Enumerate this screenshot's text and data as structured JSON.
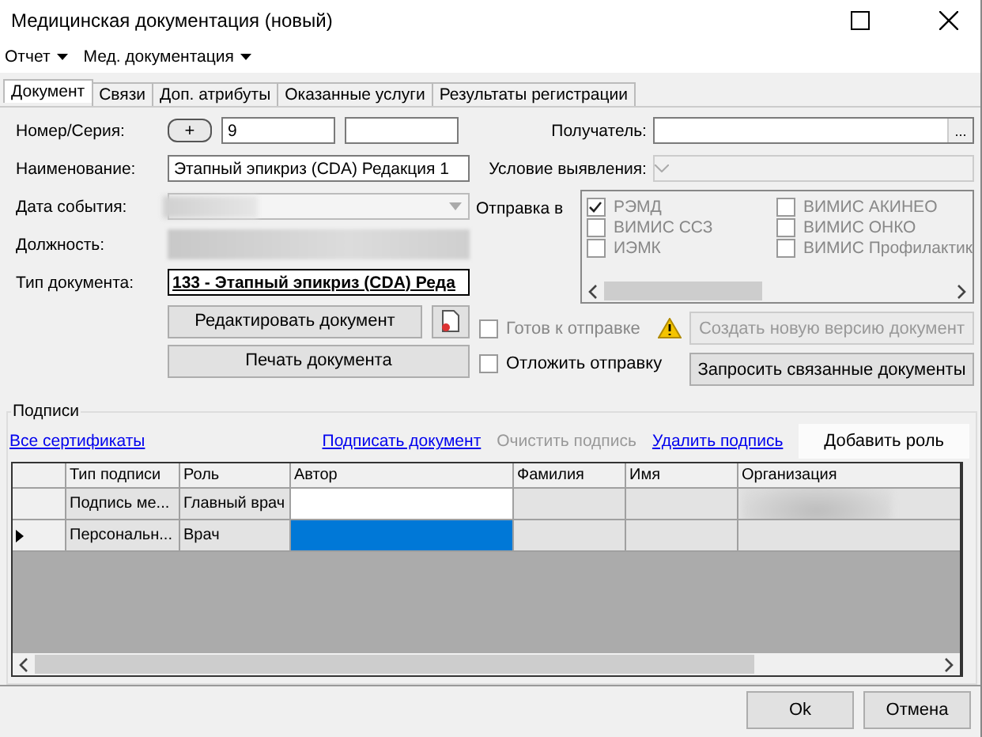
{
  "window": {
    "title": "Медицинская документация (новый)"
  },
  "menu": [
    "Отчет",
    "Мед. документация"
  ],
  "tabs": [
    {
      "label": "Документ",
      "selected": true
    },
    {
      "label": "Связи",
      "selected": false
    },
    {
      "label": "Доп. атрибуты",
      "selected": false
    },
    {
      "label": "Оказанные услуги",
      "selected": false
    },
    {
      "label": "Результаты регистрации",
      "selected": false
    }
  ],
  "form": {
    "number_label": "Номер/Серия:",
    "add_button": "+",
    "number": "9",
    "name_label": "Наименование:",
    "name": "Этапный эпикриз (CDA) Редакция 1",
    "date_label": "Дата события:",
    "position_label": "Должность:",
    "doctype_label": "Тип документа:",
    "doctype": "133 - Этапный эпикриз (CDA) Реда",
    "edit_button": "Редактировать документ",
    "print_button": "Печать документа",
    "recipient_label": "Получатель:",
    "recipient_button": "...",
    "condition_label": "Условие выявления:",
    "send_label": "Отправка в",
    "send_targets": [
      {
        "label": "РЭМД",
        "checked": true
      },
      {
        "label": "ВИМИС АКИНЕО",
        "checked": false
      },
      {
        "label": "ВИМИС ССЗ",
        "checked": false
      },
      {
        "label": "ВИМИС ОНКО",
        "checked": false
      },
      {
        "label": "ИЭМК",
        "checked": false
      },
      {
        "label": "ВИМИС Профилактик",
        "checked": false
      }
    ],
    "options": [
      {
        "label": "Готов к отправке",
        "checked": false,
        "disabled": true,
        "warning": true
      },
      {
        "label": "Отложить отправку",
        "checked": false,
        "disabled": false,
        "warning": false
      }
    ],
    "actions": [
      {
        "label": "Создать новую версию документ",
        "disabled": true
      },
      {
        "label": "Запросить связанные документы",
        "disabled": false
      }
    ]
  },
  "signatures": {
    "title": "Подписи",
    "left_link": "Все сертификаты",
    "links": [
      {
        "label": "Подписать документ",
        "disabled": false
      },
      {
        "label": "Очистить подпись",
        "disabled": true
      },
      {
        "label": "Удалить подпись",
        "disabled": false
      }
    ],
    "add_role_button": "Добавить роль",
    "columns": [
      "Тип подписи",
      "Роль",
      "Автор",
      "Фамилия",
      "Имя",
      "Организация"
    ],
    "rows": [
      {
        "type": "Подпись ме...",
        "role": "Главный врач",
        "current": false,
        "author_selected": false
      },
      {
        "type": "Персональн...",
        "role": "Врач",
        "current": true,
        "author_selected": true
      }
    ]
  },
  "buttons": [
    "Ok",
    "Отмена"
  ]
}
